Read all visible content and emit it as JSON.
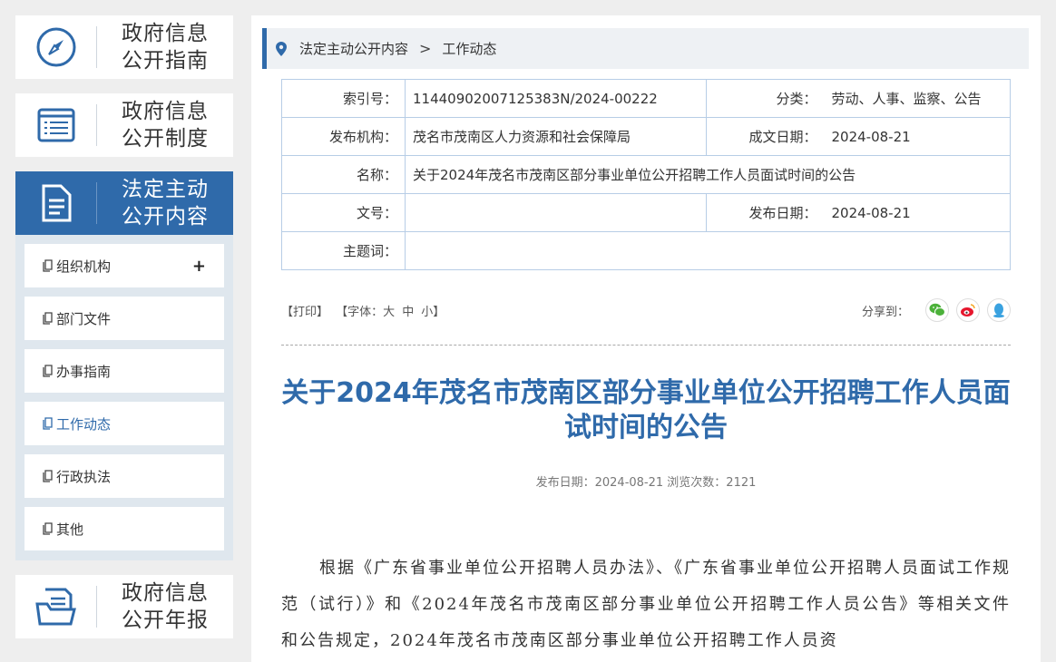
{
  "sidebar": {
    "guide": {
      "line1": "政府信息",
      "line2": "公开指南",
      "icon": "compass-icon"
    },
    "system": {
      "line1": "政府信息",
      "line2": "公开制度",
      "icon": "list-icon"
    },
    "statutory": {
      "line1": "法定主动",
      "line2": "公开内容",
      "icon": "document-icon"
    },
    "sub_items": [
      {
        "label": "组织机构",
        "expand": "+"
      },
      {
        "label": "部门文件"
      },
      {
        "label": "办事指南"
      },
      {
        "label": "工作动态"
      },
      {
        "label": "行政执法"
      },
      {
        "label": "其他"
      }
    ],
    "annual": {
      "line1": "政府信息",
      "line2": "公开年报",
      "icon": "folder-icon"
    }
  },
  "breadcrumb": {
    "level1": "法定主动公开内容",
    "separator": ">",
    "level2": "工作动态"
  },
  "meta": {
    "index_label": "索引号：",
    "index_value": "11440902007125383N/2024-00222",
    "category_label": "分类：",
    "category_value": "劳动、人事、监察、公告",
    "publisher_label": "发布机构：",
    "publisher_value": "茂名市茂南区人力资源和社会保障局",
    "created_label": "成文日期：",
    "created_value": "2024-08-21",
    "name_label": "名称：",
    "name_value": "关于2024年茂名市茂南区部分事业单位公开招聘工作人员面试时间的公告",
    "docno_label": "文号：",
    "docno_value": "",
    "publish_label": "发布日期：",
    "publish_value": "2024-08-21",
    "keywords_label": "主题词：",
    "keywords_value": ""
  },
  "tools": {
    "print": "【打印】",
    "font_prefix": "【字体：",
    "font_large": "大",
    "font_medium": "中",
    "font_small": "小",
    "font_suffix": "】",
    "share_label": "分享到："
  },
  "article": {
    "title": "关于2024年茂名市茂南区部分事业单位公开招聘工作人员面试时间的公告",
    "pub_info": "发布日期：2024-08-21  浏览次数：2121",
    "body": "根据《广东省事业单位公开招聘人员办法》、《广东省事业单位公开招聘人员面试工作规范（试行）》和《2024年茂名市茂南区部分事业单位公开招聘工作人员公告》等相关文件和公告规定，2024年茂名市茂南区部分事业单位公开招聘工作人员资"
  },
  "colors": {
    "accent": "#2f6aaa",
    "wechat": "#4cb13a",
    "weibo": "#e6162d",
    "qq": "#3aa2e0"
  }
}
